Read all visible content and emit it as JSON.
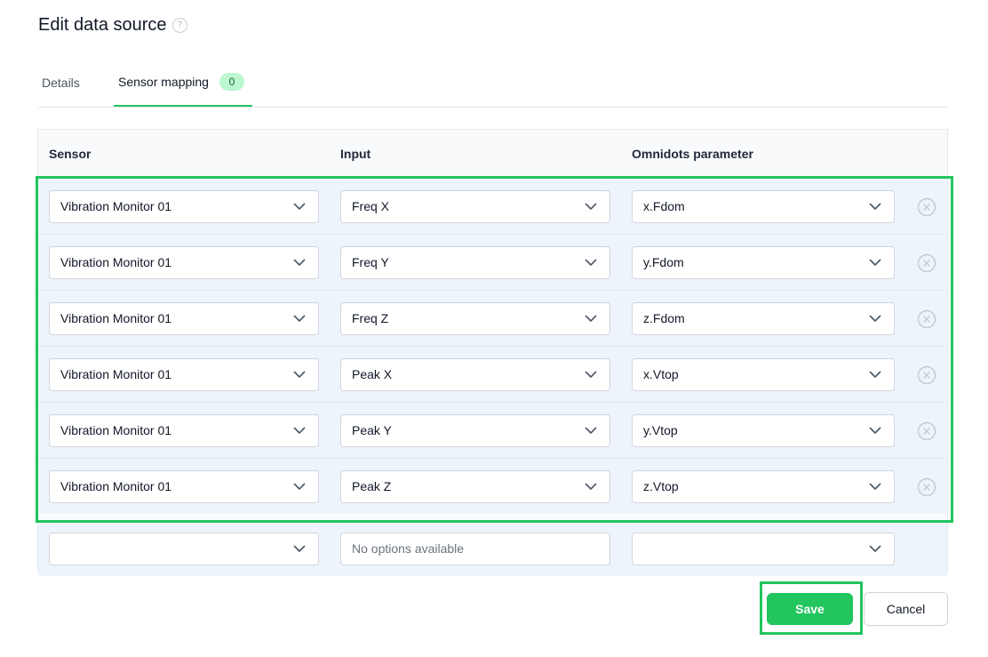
{
  "page": {
    "title": "Edit data source",
    "help_icon": "?"
  },
  "tabs": [
    {
      "label": "Details"
    },
    {
      "label": "Sensor mapping",
      "badge": "0"
    }
  ],
  "table": {
    "headers": {
      "sensor": "Sensor",
      "input": "Input",
      "parameter": "Omnidots parameter"
    },
    "rows": [
      {
        "sensor": "Vibration Monitor 01",
        "input": "Freq X",
        "parameter": "x.Fdom"
      },
      {
        "sensor": "Vibration Monitor 01",
        "input": "Freq Y",
        "parameter": "y.Fdom"
      },
      {
        "sensor": "Vibration Monitor 01",
        "input": "Freq Z",
        "parameter": "z.Fdom"
      },
      {
        "sensor": "Vibration Monitor 01",
        "input": "Peak X",
        "parameter": "x.Vtop"
      },
      {
        "sensor": "Vibration Monitor 01",
        "input": "Peak Y",
        "parameter": "y.Vtop"
      },
      {
        "sensor": "Vibration Monitor 01",
        "input": "Peak Z",
        "parameter": "z.Vtop"
      }
    ],
    "new_row": {
      "sensor": "",
      "input_placeholder": "No options available",
      "parameter": ""
    }
  },
  "actions": {
    "save": "Save",
    "cancel": "Cancel"
  },
  "colors": {
    "accent": "#22c55e",
    "badge_bg": "#bbf7d0",
    "row_bg": "#eef4fc"
  },
  "icons": {
    "chevron": "chevron-down-icon",
    "remove": "remove-circle-icon",
    "help": "help-circle-icon"
  }
}
